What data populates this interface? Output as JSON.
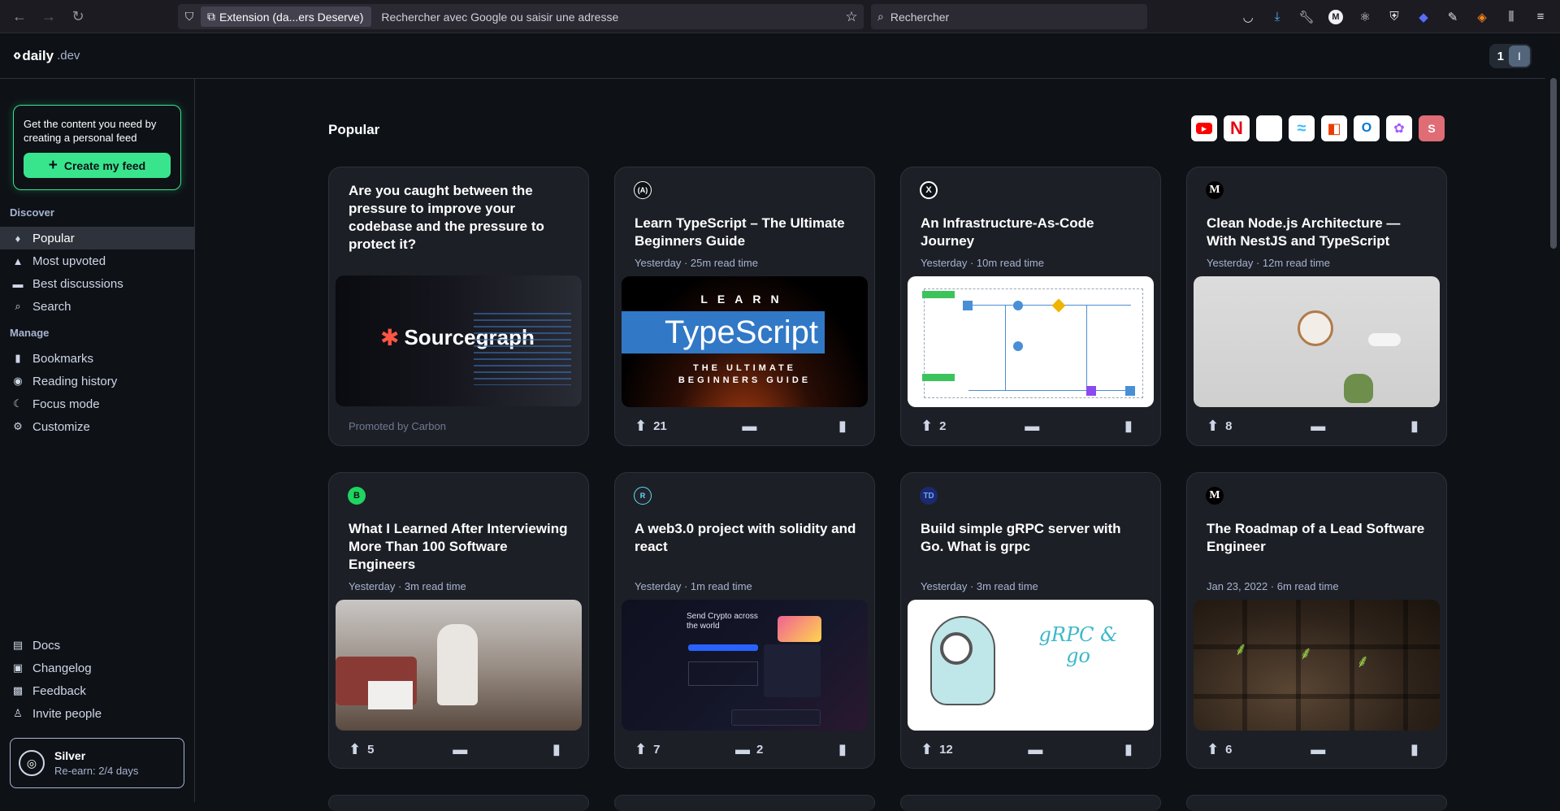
{
  "browser": {
    "extension_chip": "Extension (da...ers Deserve)",
    "url_placeholder": "Rechercher avec Google ou saisir une adresse",
    "search_placeholder": "Rechercher"
  },
  "header": {
    "logo_text": "daily",
    "logo_suffix": ".dev",
    "reputation": "1",
    "avatar_letter": "I"
  },
  "sidebar": {
    "promo_text": "Get the content you need by creating a personal feed",
    "create_feed_label": "Create my feed",
    "discover_title": "Discover",
    "discover_items": [
      {
        "label": "Popular",
        "icon": "flame-icon"
      },
      {
        "label": "Most upvoted",
        "icon": "upvote-icon"
      },
      {
        "label": "Best discussions",
        "icon": "comment-icon"
      },
      {
        "label": "Search",
        "icon": "search-icon"
      }
    ],
    "manage_title": "Manage",
    "manage_items": [
      {
        "label": "Bookmarks",
        "icon": "bookmark-icon"
      },
      {
        "label": "Reading history",
        "icon": "eye-icon"
      },
      {
        "label": "Focus mode",
        "icon": "moon-icon"
      },
      {
        "label": "Customize",
        "icon": "gear-icon"
      }
    ],
    "bottom_items": [
      {
        "label": "Docs",
        "icon": "docs-icon"
      },
      {
        "label": "Changelog",
        "icon": "terminal-icon"
      },
      {
        "label": "Feedback",
        "icon": "feedback-icon"
      },
      {
        "label": "Invite people",
        "icon": "invite-icon"
      }
    ],
    "rank_title": "Silver",
    "rank_sub": "Re-earn: 2/4 days"
  },
  "main": {
    "title": "Popular",
    "shortcuts": [
      {
        "name": "youtube",
        "color": "#ff0000"
      },
      {
        "name": "netflix",
        "color": "#e50914"
      },
      {
        "name": "blank",
        "color": "#ffffff"
      },
      {
        "name": "tailwind",
        "color": "#38bdf8"
      },
      {
        "name": "office",
        "color": "#eb3c00"
      },
      {
        "name": "outlook",
        "color": "#0078d4"
      },
      {
        "name": "figma",
        "color": "#a259ff"
      },
      {
        "name": "s",
        "color": "#e06c75",
        "letter": "S"
      }
    ],
    "cards": [
      {
        "title": "Are you caught between the pressure to improve your codebase and the pressure to protect it?",
        "promoted": "Promoted by Carbon",
        "image_text": "Sourcegraph"
      },
      {
        "source": "(A)",
        "title": "Learn TypeScript – The Ultimate Beginners Guide",
        "meta": "Yesterday · 25m read time",
        "upvotes": "21",
        "comments": "",
        "image_text": "TypeScript"
      },
      {
        "source": "X",
        "title": "An Infrastructure-As-Code Journey",
        "meta": "Yesterday · 10m read time",
        "upvotes": "2",
        "comments": ""
      },
      {
        "source": "M",
        "title": "Clean Node.js Architecture —With NestJS and TypeScript",
        "meta": "Yesterday · 12m read time",
        "upvotes": "8",
        "comments": ""
      },
      {
        "source": "B",
        "title": "What I Learned After Interviewing More Than 100 Software Engineers",
        "meta": "Yesterday · 3m read time",
        "upvotes": "5",
        "comments": ""
      },
      {
        "source": "R",
        "title": "A web3.0 project with solidity and react",
        "meta": "Yesterday · 1m read time",
        "upvotes": "7",
        "comments": "2",
        "image_text": "Send Crypto across the world"
      },
      {
        "source": "TD",
        "title": "Build simple gRPC server with Go. What is grpc",
        "meta": "Yesterday · 3m read time",
        "upvotes": "12",
        "comments": "",
        "image_text": "gRPC & go"
      },
      {
        "source": "M",
        "title": "The Roadmap of a Lead Software Engineer",
        "meta": "Jan 23, 2022 · 6m read time",
        "upvotes": "6",
        "comments": ""
      }
    ]
  }
}
